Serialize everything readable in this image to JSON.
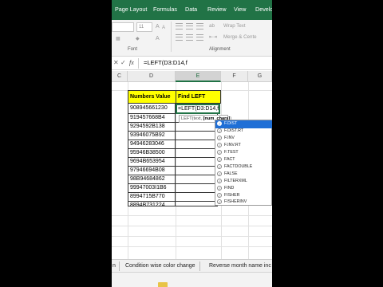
{
  "ribbon": {
    "tabs": [
      "Page Layout",
      "Formulas",
      "Data",
      "Review",
      "View",
      "Develo"
    ],
    "font_size": "11",
    "wrap_text": "Wrap Text",
    "merge_center": "Merge & Cente",
    "group_font": "Font",
    "group_alignment": "Alignment"
  },
  "formula_bar": {
    "cancel": "✕",
    "enter": "✓",
    "fx": "fx",
    "content": "=LEFT(D3:D14,f"
  },
  "columns": [
    "C",
    "D",
    "E",
    "F",
    "G"
  ],
  "headers": {
    "numbers": "Numbers Value",
    "find_left": "Find LEFT Value"
  },
  "numbers": [
    "908945661230",
    "919457668B4",
    "9294592B138",
    "93946075B92",
    "94946283046",
    "95946B38500",
    "9694B653954",
    "97946694B08",
    "98B94684862",
    "99947003I1B6",
    "8994715B770",
    "8894B731224"
  ],
  "active_cell_text": "=LEFT(D3:D14,f",
  "tooltip": {
    "prefix": "LEFT(text, ",
    "bold": "[num_chars]",
    "suffix": ")"
  },
  "autocomplete": [
    "F.DIST",
    "F.DIST.RT",
    "F.INV",
    "F.INV.RT",
    "F.TEST",
    "FACT",
    "FACTDOUBLE",
    "FALSE",
    "FILTERXML",
    "FIND",
    "FISHER",
    "FISHERINV"
  ],
  "sheet_tabs": [
    "n",
    "Condition wise color change",
    "Reverse month name inc"
  ]
}
